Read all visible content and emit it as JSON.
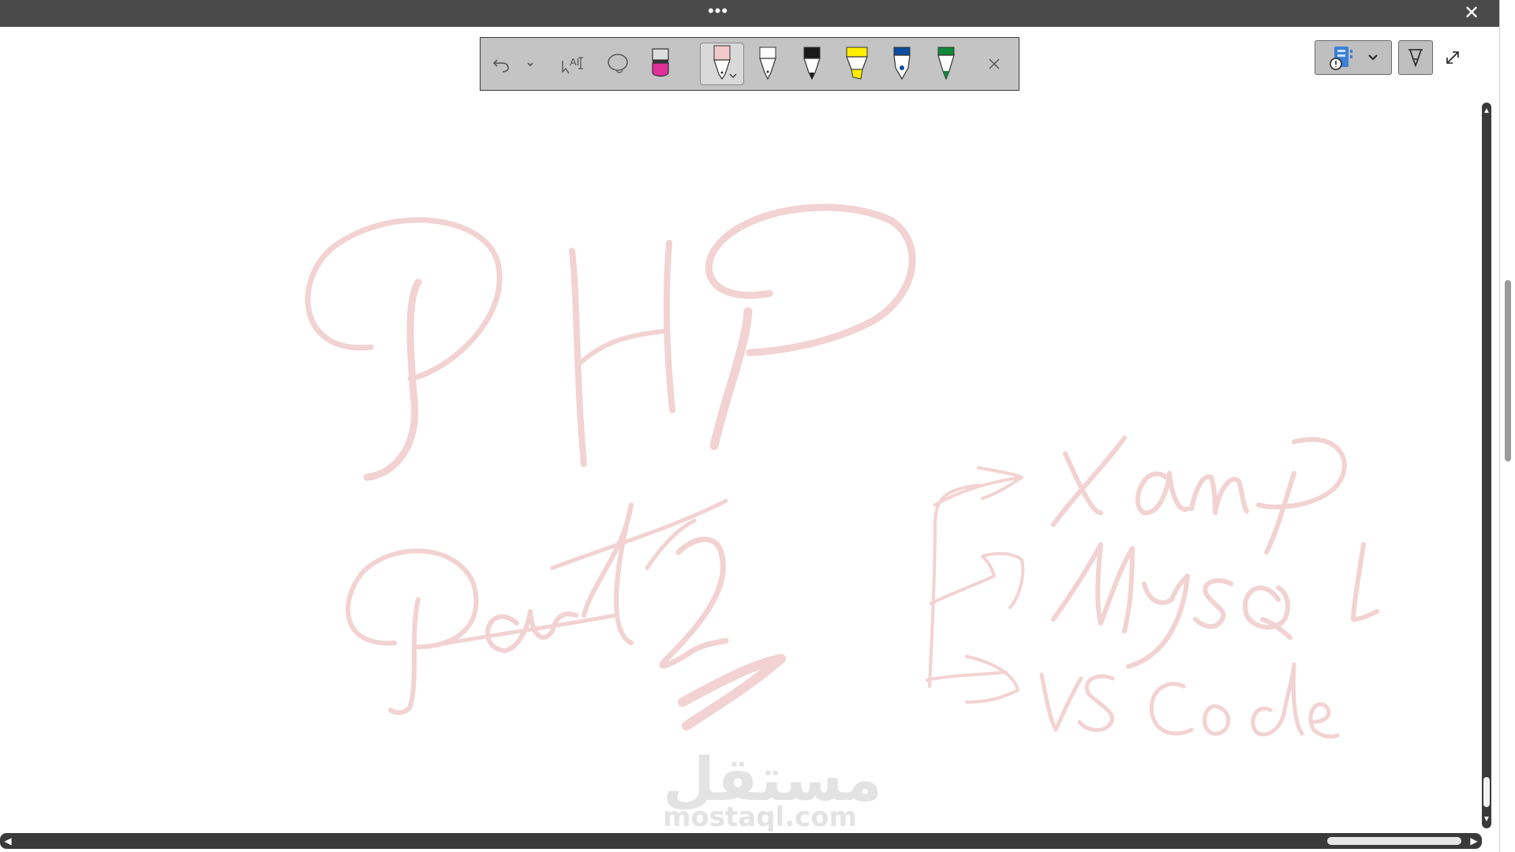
{
  "window": {
    "more_label": "•••",
    "close_label": "✕"
  },
  "toolbar": {
    "tools": [
      {
        "name": "undo",
        "icon": "undo-icon"
      },
      {
        "name": "undo-dropdown",
        "icon": "chevron-down-icon"
      },
      {
        "name": "ink-to-text",
        "icon": "ink-to-text-icon"
      },
      {
        "name": "lasso-select",
        "icon": "lasso-icon"
      },
      {
        "name": "eraser",
        "icon": "eraser-icon",
        "color": "#e0309a"
      },
      {
        "name": "pen-pink",
        "icon": "pen-icon",
        "color": "#f4c9cc",
        "selected": true
      },
      {
        "name": "pen-white",
        "icon": "pen-icon",
        "color": "#ffffff"
      },
      {
        "name": "pen-black",
        "icon": "pen-icon",
        "color": "#1a1a1a"
      },
      {
        "name": "highlighter-yellow",
        "icon": "highlighter-icon",
        "color": "#ffee00"
      },
      {
        "name": "pen-blue",
        "icon": "fountain-pen-icon",
        "color": "#0b4c9c"
      },
      {
        "name": "pen-green",
        "icon": "pen-icon",
        "color": "#12883a"
      },
      {
        "name": "close-toolbar",
        "icon": "close-icon"
      }
    ]
  },
  "canvas": {
    "ink_color": "#f2d2d2",
    "handwritten_text": [
      "PHP",
      "Part 2",
      "Xamp",
      "MySQL",
      "VS Code"
    ]
  },
  "watermark": {
    "arabic": "مستقل",
    "latin": "mostaql.com"
  },
  "colors": {
    "titlebar": "#4a4a4a",
    "toolbar_bg": "#c4c4c4",
    "canvas_bg": "#ffffff",
    "scrollbar": "#3a3a3a"
  }
}
